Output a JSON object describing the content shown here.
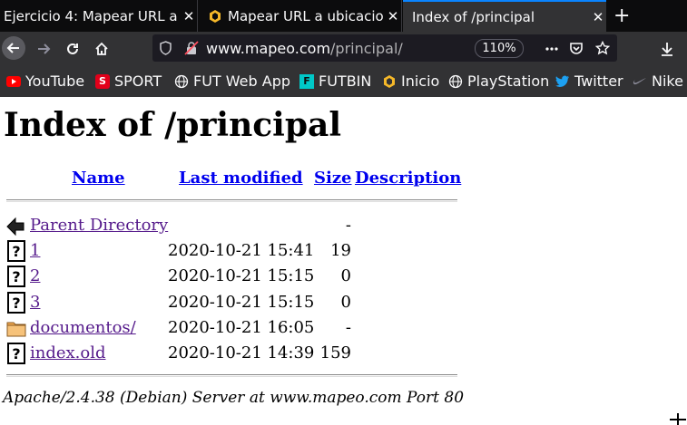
{
  "tabs": [
    {
      "label": "Ejercicio 4: Mapear URL a",
      "close": "✕"
    },
    {
      "label": "Mapear URL a ubicacion",
      "close": "✕"
    },
    {
      "label": "Index of /principal",
      "close": "✕"
    }
  ],
  "newtab": "+",
  "url": {
    "host": "www.mapeo.com",
    "path": "/principal/"
  },
  "zoom": "110%",
  "bookmarks": [
    "YouTube",
    "SPORT",
    "FUT Web App",
    "FUTBIN",
    "Inicio",
    "PlayStation",
    "Twitter",
    "Nike"
  ],
  "listing": {
    "title": "Index of /principal",
    "headers": {
      "name": "Name",
      "modified": "Last modified",
      "size": "Size",
      "description": "Description"
    },
    "rows": [
      {
        "name": "Parent Directory",
        "modified": "",
        "size": "-",
        "icon": "back-arrow-icon"
      },
      {
        "name": "1",
        "modified": "2020-10-21 15:41",
        "size": "19",
        "icon": "unknown-file-icon"
      },
      {
        "name": "2",
        "modified": "2020-10-21 15:15",
        "size": "0",
        "icon": "unknown-file-icon"
      },
      {
        "name": "3",
        "modified": "2020-10-21 15:15",
        "size": "0",
        "icon": "unknown-file-icon"
      },
      {
        "name": "documentos/",
        "modified": "2020-10-21 16:05",
        "size": "-",
        "icon": "folder-icon"
      },
      {
        "name": "index.old",
        "modified": "2020-10-21 14:39",
        "size": "159",
        "icon": "unknown-file-icon"
      }
    ],
    "address": "Apache/2.4.38 (Debian) Server at www.mapeo.com Port 80"
  },
  "colors": {
    "accent": "#0a84ff",
    "link": "#0000ee",
    "visited": "#551a8b",
    "chrome": "#323234"
  }
}
